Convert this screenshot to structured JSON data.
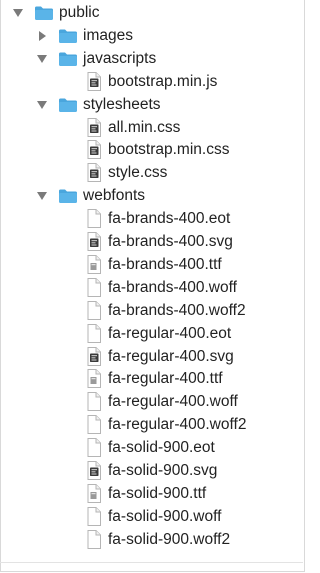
{
  "tree": {
    "rows": [
      {
        "name": "public",
        "type": "folder",
        "expanded": true,
        "depth": 0
      },
      {
        "name": "images",
        "type": "folder",
        "expanded": false,
        "depth": 1
      },
      {
        "name": "javascripts",
        "type": "folder",
        "expanded": true,
        "depth": 1
      },
      {
        "name": "bootstrap.min.js",
        "type": "file",
        "icon": "script-file-icon",
        "depth": 2
      },
      {
        "name": "stylesheets",
        "type": "folder",
        "expanded": true,
        "depth": 1
      },
      {
        "name": "all.min.css",
        "type": "file",
        "icon": "script-file-icon",
        "depth": 2
      },
      {
        "name": "bootstrap.min.css",
        "type": "file",
        "icon": "script-file-icon",
        "depth": 2
      },
      {
        "name": "style.css",
        "type": "file",
        "icon": "script-file-icon",
        "depth": 2
      },
      {
        "name": "webfonts",
        "type": "folder",
        "expanded": true,
        "depth": 1
      },
      {
        "name": "fa-brands-400.eot",
        "type": "file",
        "icon": "blank-file-icon",
        "depth": 2
      },
      {
        "name": "fa-brands-400.svg",
        "type": "file",
        "icon": "script-file-icon",
        "depth": 2
      },
      {
        "name": "fa-brands-400.ttf",
        "type": "file",
        "icon": "font-file-icon",
        "depth": 2
      },
      {
        "name": "fa-brands-400.woff",
        "type": "file",
        "icon": "blank-file-icon",
        "depth": 2
      },
      {
        "name": "fa-brands-400.woff2",
        "type": "file",
        "icon": "blank-file-icon",
        "depth": 2
      },
      {
        "name": "fa-regular-400.eot",
        "type": "file",
        "icon": "blank-file-icon",
        "depth": 2
      },
      {
        "name": "fa-regular-400.svg",
        "type": "file",
        "icon": "script-file-icon",
        "depth": 2
      },
      {
        "name": "fa-regular-400.ttf",
        "type": "file",
        "icon": "font-file-icon",
        "depth": 2
      },
      {
        "name": "fa-regular-400.woff",
        "type": "file",
        "icon": "blank-file-icon",
        "depth": 2
      },
      {
        "name": "fa-regular-400.woff2",
        "type": "file",
        "icon": "blank-file-icon",
        "depth": 2
      },
      {
        "name": "fa-solid-900.eot",
        "type": "file",
        "icon": "blank-file-icon",
        "depth": 2
      },
      {
        "name": "fa-solid-900.svg",
        "type": "file",
        "icon": "script-file-icon",
        "depth": 2
      },
      {
        "name": "fa-solid-900.ttf",
        "type": "file",
        "icon": "font-file-icon",
        "depth": 2
      },
      {
        "name": "fa-solid-900.woff",
        "type": "file",
        "icon": "blank-file-icon",
        "depth": 2
      },
      {
        "name": "fa-solid-900.woff2",
        "type": "file",
        "icon": "blank-file-icon",
        "depth": 2
      }
    ]
  },
  "colors": {
    "folder": "#5ab4e8",
    "folder_tab": "#4aa6dd",
    "disclosure": "#7a7a7a",
    "text": "#222222",
    "file_border": "#b5b5b5",
    "script_icon": "#3a3a3a"
  }
}
